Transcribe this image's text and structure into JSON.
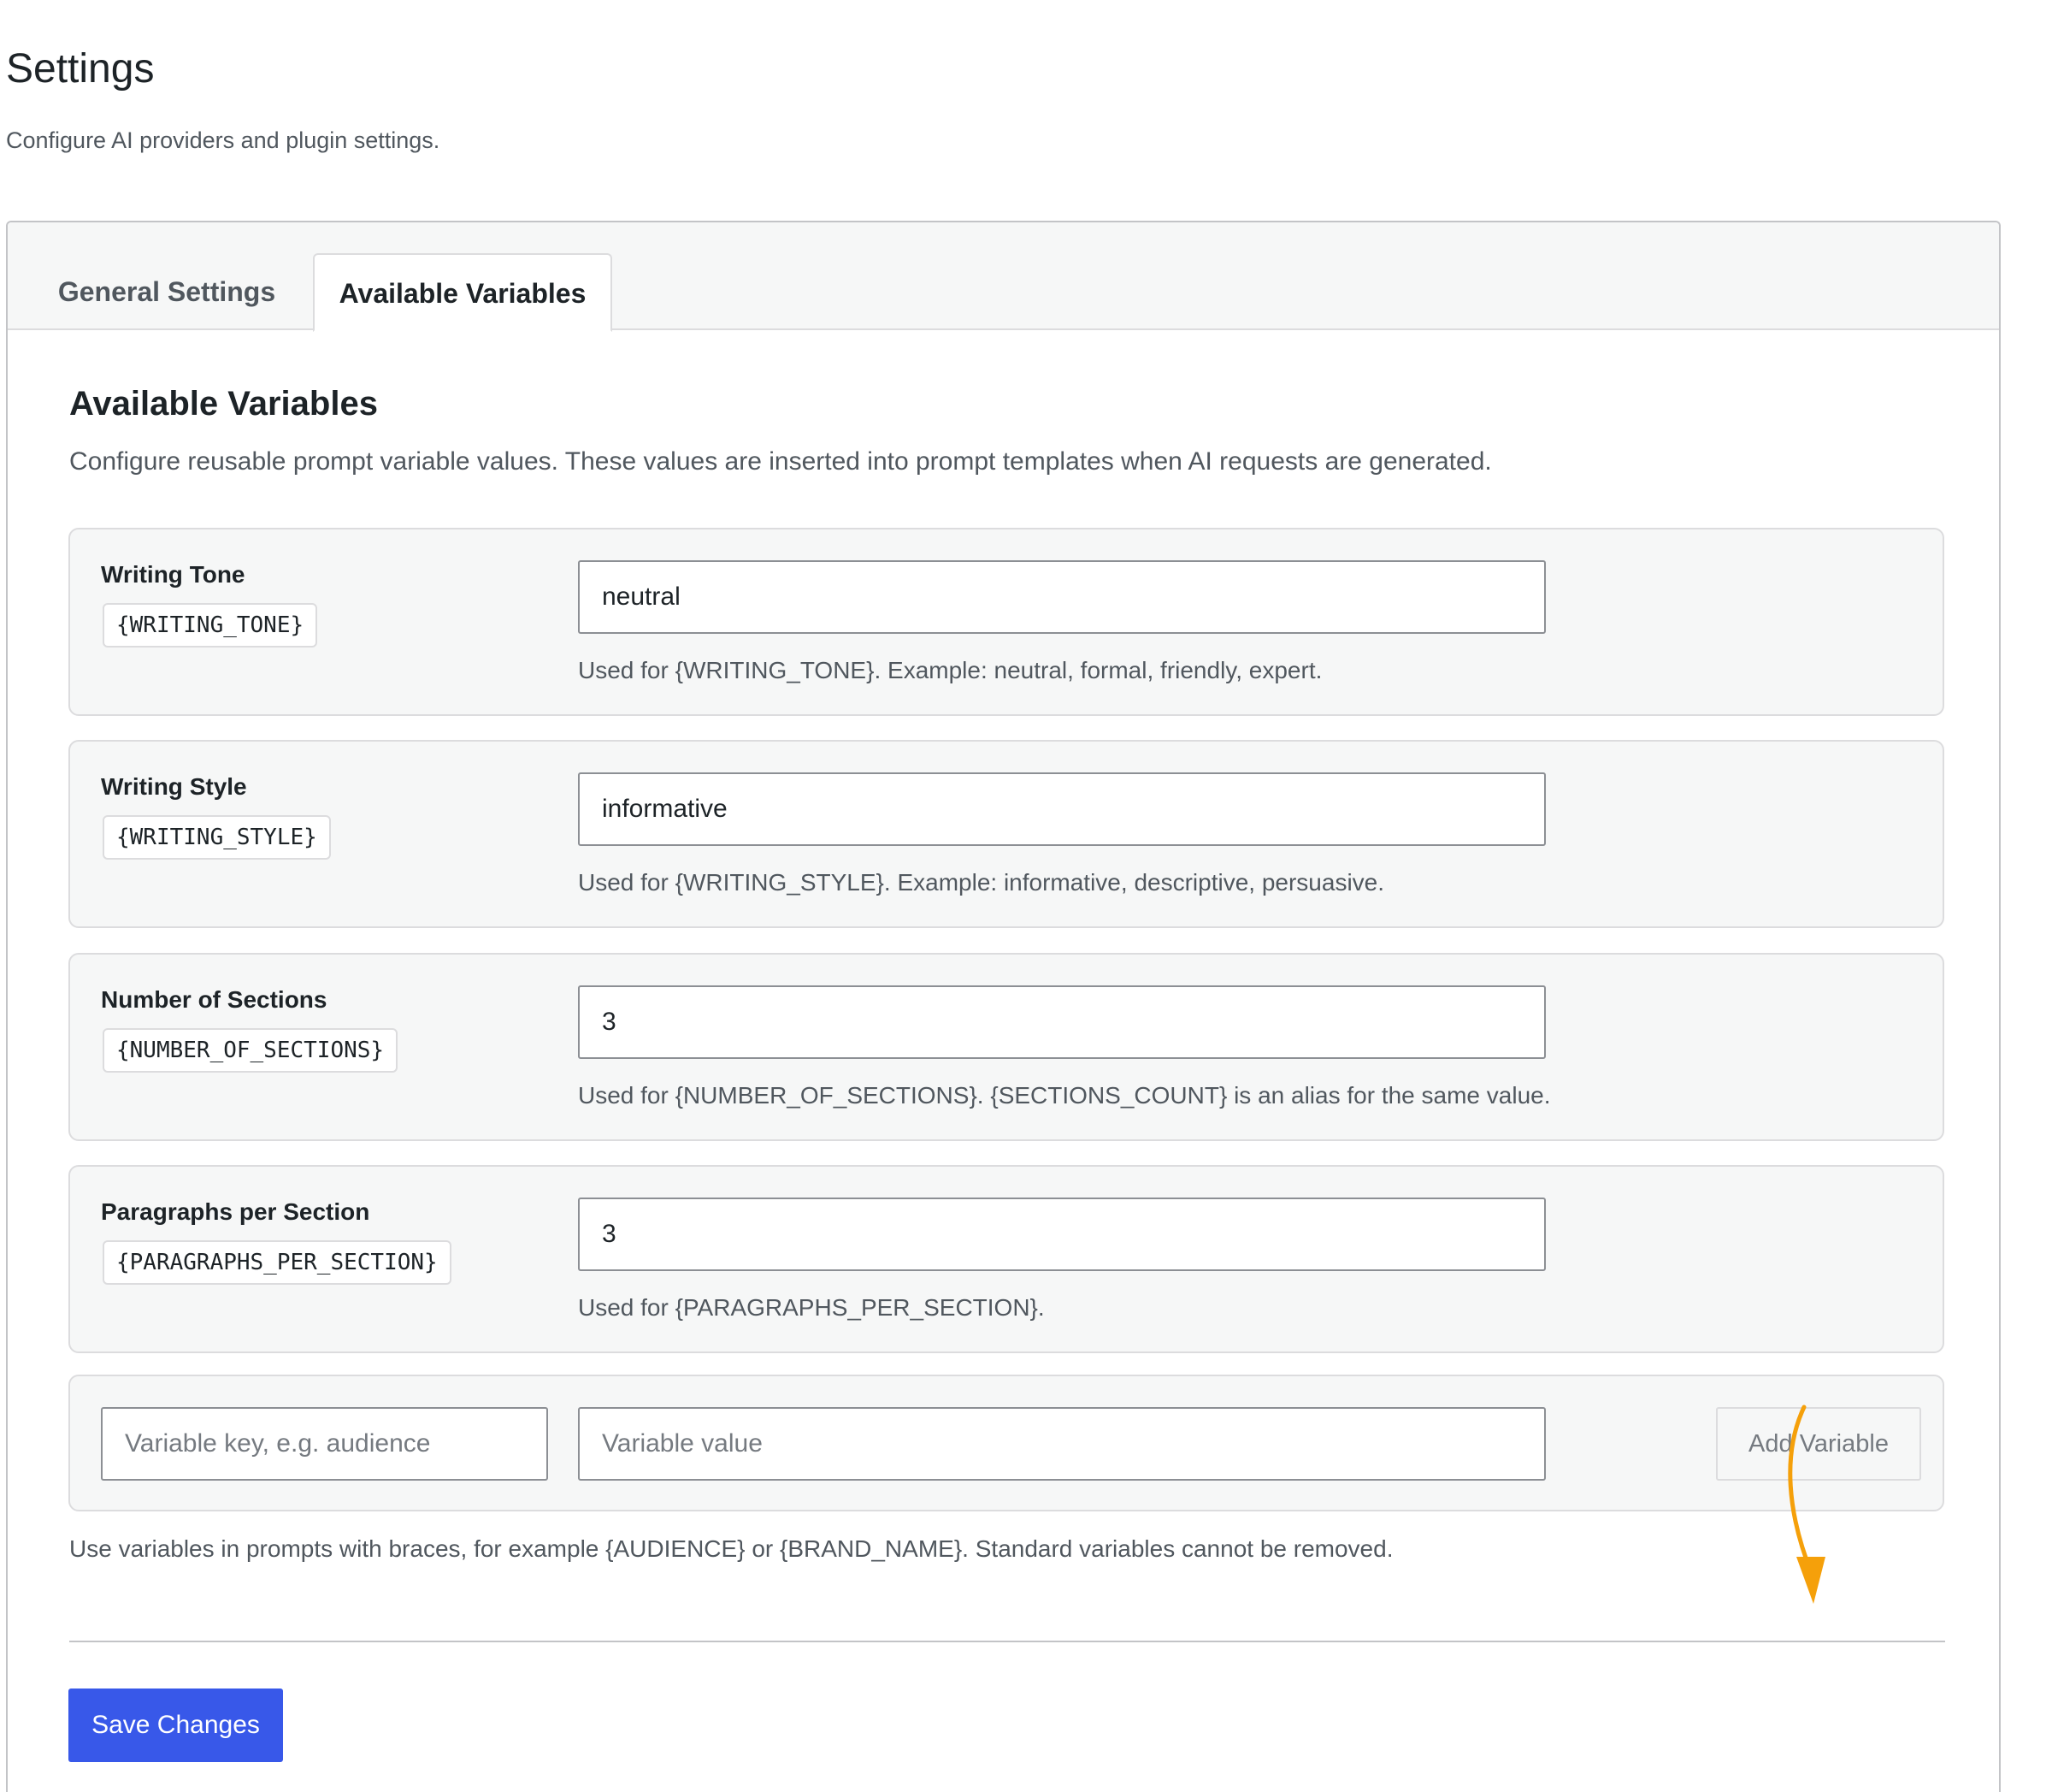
{
  "header": {
    "title": "Settings",
    "subtitle": "Configure AI providers and plugin settings."
  },
  "tabs": [
    {
      "label": "General Settings",
      "active": false
    },
    {
      "label": "Available Variables",
      "active": true
    }
  ],
  "section": {
    "title": "Available Variables",
    "description": "Configure reusable prompt variable values. These values are inserted into prompt templates when AI requests are generated."
  },
  "variables": [
    {
      "label": "Writing Tone",
      "key": "{WRITING_TONE}",
      "value": "neutral",
      "help": "Used for {WRITING_TONE}. Example: neutral, formal, friendly, expert."
    },
    {
      "label": "Writing Style",
      "key": "{WRITING_STYLE}",
      "value": "informative",
      "help": "Used for {WRITING_STYLE}. Example: informative, descriptive, persuasive."
    },
    {
      "label": "Number of Sections",
      "key": "{NUMBER_OF_SECTIONS}",
      "value": "3",
      "help": "Used for {NUMBER_OF_SECTIONS}. {SECTIONS_COUNT} is an alias for the same value."
    },
    {
      "label": "Paragraphs per Section",
      "key": "{PARAGRAPHS_PER_SECTION}",
      "value": "3",
      "help": "Used for {PARAGRAPHS_PER_SECTION}."
    }
  ],
  "add_variable": {
    "key_placeholder": "Variable key, e.g. audience",
    "value_placeholder": "Variable value",
    "button_label": "Add Variable"
  },
  "footnote": "Use variables in prompts with braces, for example {AUDIENCE} or {BRAND_NAME}. Standard variables cannot be removed.",
  "save_label": "Save Changes",
  "colors": {
    "primary_button": "#3858e9",
    "annotation_arrow": "#f5a00a",
    "card_background": "#f6f7f7"
  }
}
